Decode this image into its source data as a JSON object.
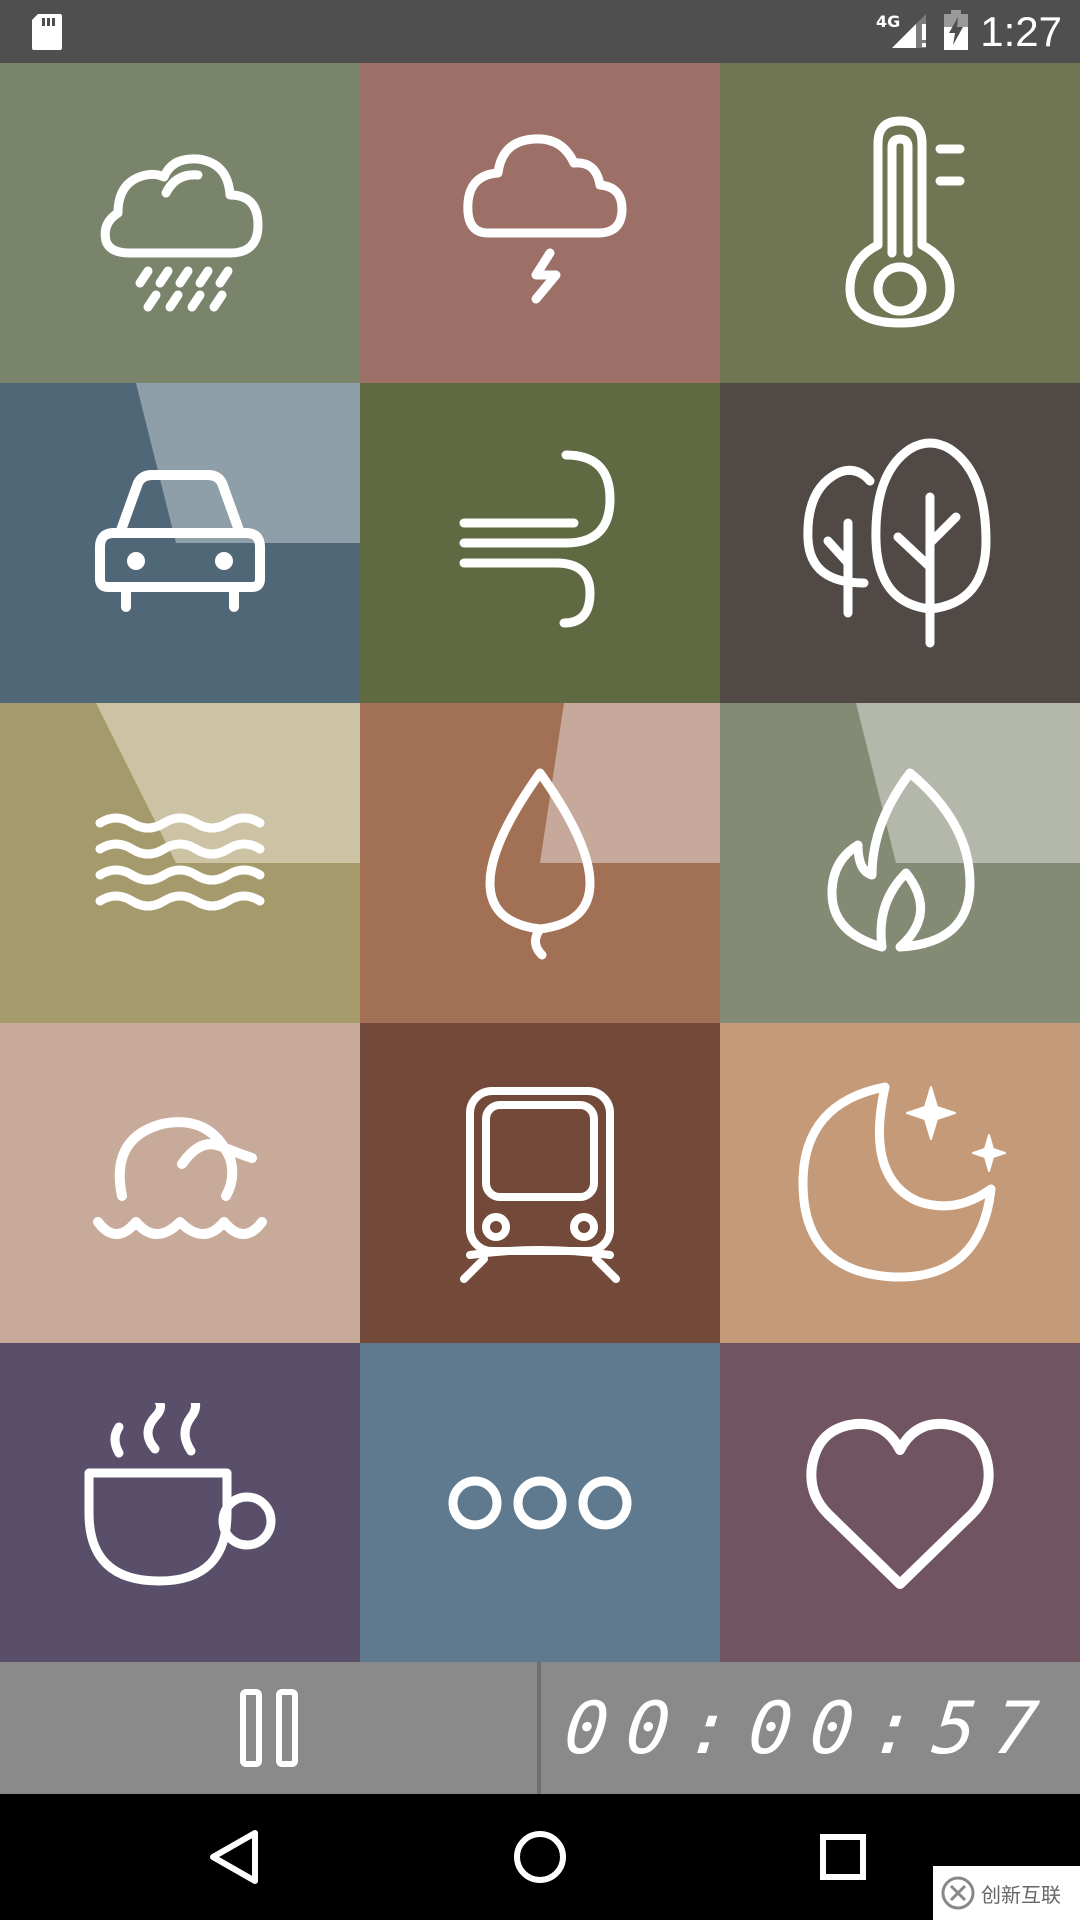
{
  "status_bar": {
    "time": "1:27",
    "network": "4G",
    "icons": [
      "sd-card-icon",
      "cell-signal-icon",
      "battery-charging-icon"
    ]
  },
  "sounds": [
    {
      "id": "rain",
      "icon": "rain-cloud-icon",
      "color": "#7a846b"
    },
    {
      "id": "thunderstorm",
      "icon": "thunder-cloud-icon",
      "color": "#9c7066"
    },
    {
      "id": "temperature",
      "icon": "thermometer-icon",
      "color": "#707553"
    },
    {
      "id": "car",
      "icon": "car-icon",
      "color": "#506778"
    },
    {
      "id": "wind",
      "icon": "wind-icon",
      "color": "#5f6a42"
    },
    {
      "id": "forest",
      "icon": "trees-icon",
      "color": "#514945"
    },
    {
      "id": "water",
      "icon": "waves-icon",
      "color": "#a59a6b"
    },
    {
      "id": "leaf",
      "icon": "leaf-icon",
      "color": "#a27055"
    },
    {
      "id": "fire",
      "icon": "flame-icon",
      "color": "#838b75"
    },
    {
      "id": "ocean",
      "icon": "ocean-wave-icon",
      "color": "#c8aa9a"
    },
    {
      "id": "train",
      "icon": "train-icon",
      "color": "#734a39"
    },
    {
      "id": "night",
      "icon": "moon-stars-icon",
      "color": "#c49a78"
    },
    {
      "id": "coffee",
      "icon": "coffee-cup-icon",
      "color": "#594f6b"
    },
    {
      "id": "more",
      "icon": "more-dots-icon",
      "color": "#5f7a8e"
    },
    {
      "id": "favorites",
      "icon": "heart-icon",
      "color": "#705462"
    }
  ],
  "player": {
    "timer": "00:00:57",
    "pause_icon": "pause-icon"
  },
  "watermark": {
    "text": "创新互联"
  },
  "nav": {
    "icons": [
      "back-icon",
      "home-icon",
      "recents-icon"
    ]
  }
}
